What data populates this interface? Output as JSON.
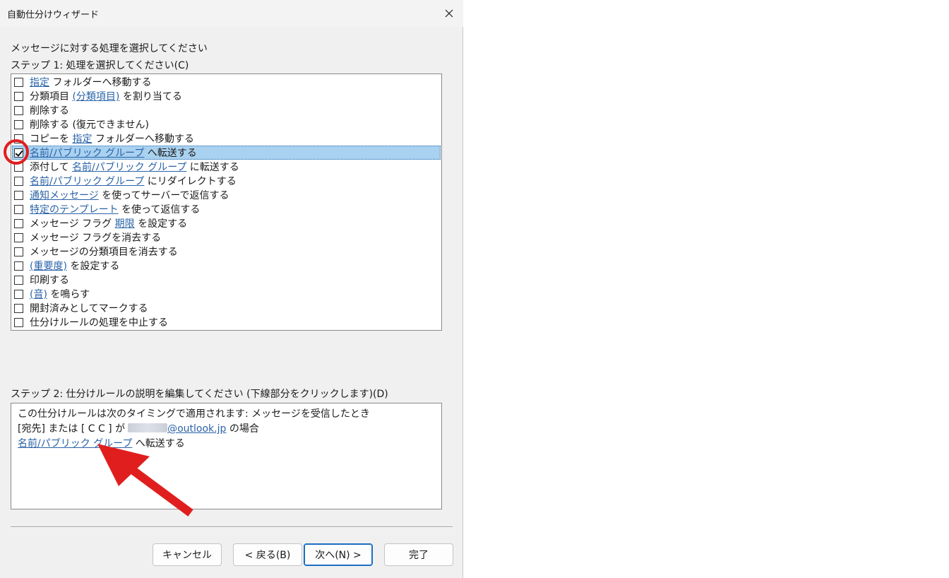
{
  "window": {
    "title": "自動仕分けウィザード"
  },
  "prompt": "メッセージに対する処理を選択してください",
  "step1_label": "ステップ 1: 処理を選択してください(C)",
  "actions": [
    {
      "pre": "",
      "link": "指定",
      "post": " フォルダーへ移動する",
      "checked": false
    },
    {
      "pre": "分類項目 ",
      "link": "(分類項目)",
      "post": " を割り当てる",
      "checked": false
    },
    {
      "pre": "削除する",
      "link": "",
      "post": "",
      "checked": false
    },
    {
      "pre": "削除する (復元できません)",
      "link": "",
      "post": "",
      "checked": false
    },
    {
      "pre": "コピーを ",
      "link": "指定",
      "post": " フォルダーへ移動する",
      "checked": false
    },
    {
      "pre": "",
      "link": "名前/パブリック グループ",
      "post": " へ転送する",
      "checked": true,
      "selected": true
    },
    {
      "pre": "添付して ",
      "link": "名前/パブリック グループ",
      "post": " に転送する",
      "checked": false
    },
    {
      "pre": "",
      "link": "名前/パブリック グループ",
      "post": " にリダイレクトする",
      "checked": false
    },
    {
      "pre": "",
      "link": "通知メッセージ",
      "post": " を使ってサーバーで返信する",
      "checked": false
    },
    {
      "pre": "",
      "link": "特定のテンプレート",
      "post": " を使って返信する",
      "checked": false
    },
    {
      "pre": "メッセージ フラグ ",
      "link": "期限",
      "post": " を設定する",
      "checked": false
    },
    {
      "pre": "メッセージ フラグを消去する",
      "link": "",
      "post": "",
      "checked": false
    },
    {
      "pre": "メッセージの分類項目を消去する",
      "link": "",
      "post": "",
      "checked": false
    },
    {
      "pre": "",
      "link": "(重要度)",
      "post": " を設定する",
      "checked": false
    },
    {
      "pre": "印刷する",
      "link": "",
      "post": "",
      "checked": false
    },
    {
      "pre": "",
      "link": "(音)",
      "post": " を鳴らす",
      "checked": false
    },
    {
      "pre": "開封済みとしてマークする",
      "link": "",
      "post": "",
      "checked": false
    },
    {
      "pre": "仕分けルールの処理を中止する",
      "link": "",
      "post": "",
      "checked": false
    }
  ],
  "step2_label": "ステップ 2: 仕分けルールの説明を編集してください (下線部分をクリックします)(D)",
  "description": {
    "line1": "この仕分けルールは次のタイミングで適用されます: メッセージを受信したとき",
    "line2_pre": "[宛先] または [ C C ] が",
    "line2_link": "@outlook.jp",
    "line2_post": " の場合",
    "line3_link": "名前/パブリック グループ",
    "line3_post": " へ転送する"
  },
  "buttons": {
    "cancel": "キャンセル",
    "back": "< 戻る(B)",
    "next": "次へ(N) >",
    "finish": "完了"
  },
  "colors": {
    "link": "#2a63a8",
    "selection": "#a9d1f0",
    "annotation": "#e01e1e"
  },
  "icons": {
    "close": "close-icon",
    "check": "check-icon"
  }
}
